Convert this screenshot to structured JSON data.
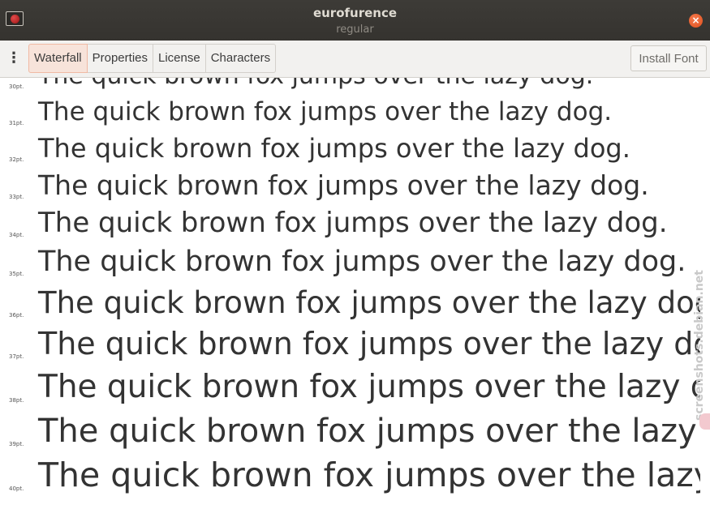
{
  "window": {
    "title": "eurofurence",
    "subtitle": "regular"
  },
  "toolbar": {
    "tabs": [
      {
        "label": "Waterfall",
        "active": true
      },
      {
        "label": "Properties",
        "active": false
      },
      {
        "label": "License",
        "active": false
      },
      {
        "label": "Characters",
        "active": false
      }
    ],
    "install_label": "Install Font"
  },
  "sample_text": "The quick brown fox jumps over the lazy dog.",
  "rows": [
    {
      "size_label": "30pt.",
      "size": 30
    },
    {
      "size_label": "31pt.",
      "size": 31
    },
    {
      "size_label": "32pt.",
      "size": 32
    },
    {
      "size_label": "33pt.",
      "size": 33
    },
    {
      "size_label": "34pt.",
      "size": 34
    },
    {
      "size_label": "35pt.",
      "size": 35
    },
    {
      "size_label": "36pt.",
      "size": 36
    },
    {
      "size_label": "37pt.",
      "size": 37
    },
    {
      "size_label": "38pt.",
      "size": 38
    },
    {
      "size_label": "39pt.",
      "size": 39
    },
    {
      "size_label": "40pt.",
      "size": 40
    }
  ],
  "watermark": "screenshots.debian.net",
  "icons": {
    "app": "font-app-icon",
    "close": "close-icon",
    "menu": "menu-icon"
  }
}
